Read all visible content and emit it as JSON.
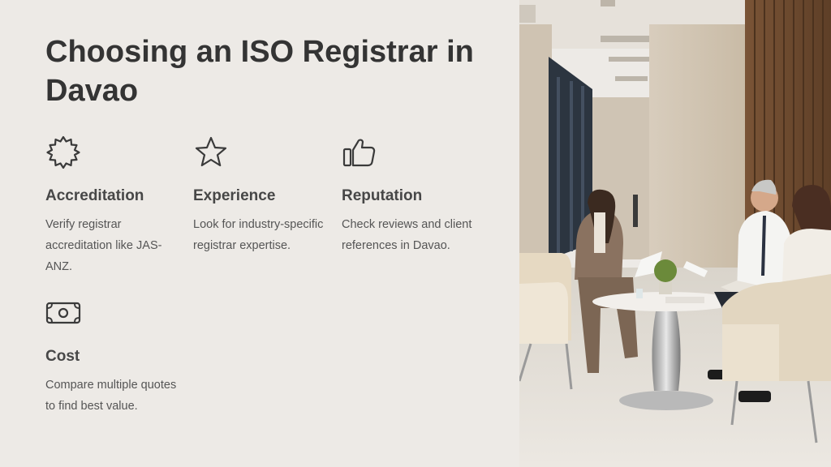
{
  "slide": {
    "title": "Choosing an ISO Registrar in Davao",
    "cards": [
      {
        "icon": "seal-badge-icon",
        "heading": "Accreditation",
        "description": "Verify registrar accreditation like JAS-ANZ."
      },
      {
        "icon": "star-icon",
        "heading": "Experience",
        "description": "Look for industry-specific registrar expertise."
      },
      {
        "icon": "thumbs-up-icon",
        "heading": "Reputation",
        "description": "Check reviews and client references in Davao."
      },
      {
        "icon": "banknote-icon",
        "heading": "Cost",
        "description": "Compare multiple quotes to find best value."
      }
    ],
    "photo": {
      "subject": "office-meeting-photo"
    }
  }
}
